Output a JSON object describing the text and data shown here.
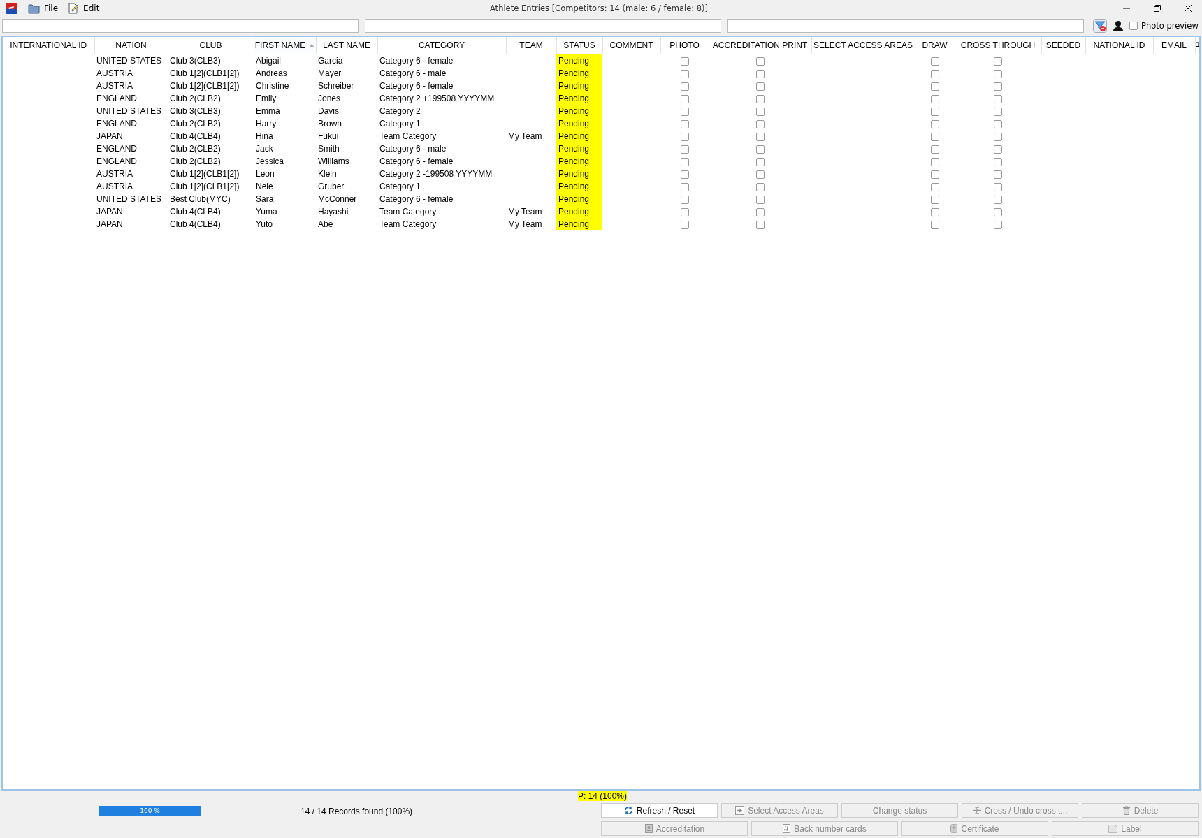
{
  "window": {
    "title": "Athlete Entries [Competitors: 14 (male: 6 / female: 8)]"
  },
  "menu": [
    {
      "label": "File"
    },
    {
      "label": "Edit"
    }
  ],
  "photo_preview": {
    "label": "Photo preview",
    "checked": false
  },
  "columns": [
    {
      "label": "INTERNATIONAL ID",
      "kind": "text",
      "sorted": false
    },
    {
      "label": "NATION",
      "kind": "text",
      "sorted": false
    },
    {
      "label": "CLUB",
      "kind": "text",
      "sorted": false
    },
    {
      "label": "FIRST NAME",
      "kind": "text",
      "sorted": true
    },
    {
      "label": "LAST NAME",
      "kind": "text",
      "sorted": false
    },
    {
      "label": "CATEGORY",
      "kind": "text",
      "sorted": false
    },
    {
      "label": "TEAM",
      "kind": "text",
      "sorted": false
    },
    {
      "label": "STATUS",
      "kind": "status",
      "sorted": false
    },
    {
      "label": "COMMENT",
      "kind": "text",
      "sorted": false
    },
    {
      "label": "PHOTO",
      "kind": "checkbox",
      "sorted": false
    },
    {
      "label": "ACCREDITATION PRINT",
      "kind": "checkbox",
      "sorted": false
    },
    {
      "label": "SELECT ACCESS AREAS",
      "kind": "text",
      "sorted": false
    },
    {
      "label": "DRAW",
      "kind": "checkbox",
      "sorted": false
    },
    {
      "label": "CROSS THROUGH",
      "kind": "checkbox",
      "sorted": false
    },
    {
      "label": "SEEDED",
      "kind": "text",
      "sorted": false
    },
    {
      "label": "NATIONAL ID",
      "kind": "text",
      "sorted": false
    },
    {
      "label": "EMAIL",
      "kind": "text",
      "sorted": false
    }
  ],
  "rows": [
    {
      "nation": "UNITED STATES",
      "club": "Club 3(CLB3)",
      "first_name": "Abigail",
      "last_name": "Garcia",
      "category": "Category 6 - female",
      "status": "Pending",
      "photo": false,
      "accreditation_print": false,
      "draw": false,
      "cross_through": false
    },
    {
      "nation": "AUSTRIA",
      "club": "Club 1[2](CLB1[2])",
      "first_name": "Andreas",
      "last_name": "Mayer",
      "category": "Category 6 - male",
      "status": "Pending",
      "photo": false,
      "accreditation_print": false,
      "draw": false,
      "cross_through": false
    },
    {
      "nation": "AUSTRIA",
      "club": "Club 1[2](CLB1[2])",
      "first_name": "Christine",
      "last_name": "Schreiber",
      "category": "Category 6 - female",
      "status": "Pending",
      "photo": false,
      "accreditation_print": false,
      "draw": false,
      "cross_through": false
    },
    {
      "nation": "ENGLAND",
      "club": "Club 2(CLB2)",
      "first_name": "Emily",
      "last_name": "Jones",
      "category": "Category 2 +199508 YYYYMM",
      "status": "Pending",
      "photo": false,
      "accreditation_print": false,
      "draw": false,
      "cross_through": false
    },
    {
      "nation": "UNITED STATES",
      "club": "Club 3(CLB3)",
      "first_name": "Emma",
      "last_name": "Davis",
      "category": "Category 2",
      "status": "Pending",
      "photo": false,
      "accreditation_print": false,
      "draw": false,
      "cross_through": false
    },
    {
      "nation": "ENGLAND",
      "club": "Club 2(CLB2)",
      "first_name": "Harry",
      "last_name": "Brown",
      "category": "Category 1",
      "status": "Pending",
      "photo": false,
      "accreditation_print": false,
      "draw": false,
      "cross_through": false
    },
    {
      "nation": "JAPAN",
      "club": "Club 4(CLB4)",
      "first_name": "Hina",
      "last_name": "Fukui",
      "category": "Team Category",
      "team": "My Team",
      "status": "Pending",
      "photo": false,
      "accreditation_print": false,
      "draw": false,
      "cross_through": false
    },
    {
      "nation": "ENGLAND",
      "club": "Club 2(CLB2)",
      "first_name": "Jack",
      "last_name": "Smith",
      "category": "Category 6 - male",
      "status": "Pending",
      "photo": false,
      "accreditation_print": false,
      "draw": false,
      "cross_through": false
    },
    {
      "nation": "ENGLAND",
      "club": "Club 2(CLB2)",
      "first_name": "Jessica",
      "last_name": "Williams",
      "category": "Category 6 - female",
      "status": "Pending",
      "photo": false,
      "accreditation_print": false,
      "draw": false,
      "cross_through": false
    },
    {
      "nation": "AUSTRIA",
      "club": "Club 1[2](CLB1[2])",
      "first_name": "Leon",
      "last_name": "Klein",
      "category": "Category 2 -199508 YYYYMM",
      "status": "Pending",
      "photo": false,
      "accreditation_print": false,
      "draw": false,
      "cross_through": false
    },
    {
      "nation": "AUSTRIA",
      "club": "Club 1[2](CLB1[2])",
      "first_name": "Nele",
      "last_name": "Gruber",
      "category": "Category 1",
      "status": "Pending",
      "photo": false,
      "accreditation_print": false,
      "draw": false,
      "cross_through": false
    },
    {
      "nation": "UNITED STATES",
      "club": "Best Club(MYC)",
      "first_name": "Sara",
      "last_name": "McConner",
      "category": "Category 6 - female",
      "status": "Pending",
      "photo": false,
      "accreditation_print": false,
      "draw": false,
      "cross_through": false
    },
    {
      "nation": "JAPAN",
      "club": "Club 4(CLB4)",
      "first_name": "Yuma",
      "last_name": "Hayashi",
      "category": "Team Category",
      "team": "My Team",
      "status": "Pending",
      "photo": false,
      "accreditation_print": false,
      "draw": false,
      "cross_through": false
    },
    {
      "nation": "JAPAN",
      "club": "Club 4(CLB4)",
      "first_name": "Yuto",
      "last_name": "Abe",
      "category": "Team Category",
      "team": "My Team",
      "status": "Pending",
      "photo": false,
      "accreditation_print": false,
      "draw": false,
      "cross_through": false
    }
  ],
  "status_bar": {
    "pending_summary": "P: 14 (100%)",
    "progress": {
      "level": 1.0,
      "label": "100 %"
    },
    "records_found": "14 / 14 Records found (100%)"
  },
  "buttons": [
    [
      {
        "label": "Refresh / Reset",
        "disabled": false
      },
      {
        "label": "Select Access Areas",
        "disabled": true
      },
      {
        "label": "Change status",
        "disabled": true
      },
      {
        "label": "Cross / Undo cross t...",
        "disabled": true
      },
      {
        "label": "Delete",
        "disabled": true
      }
    ],
    [
      {
        "label": "Accreditation",
        "disabled": true
      },
      {
        "label": "Back number cards",
        "disabled": true
      },
      {
        "label": "Certificate",
        "disabled": true
      },
      {
        "label": "Label",
        "disabled": true
      }
    ]
  ]
}
